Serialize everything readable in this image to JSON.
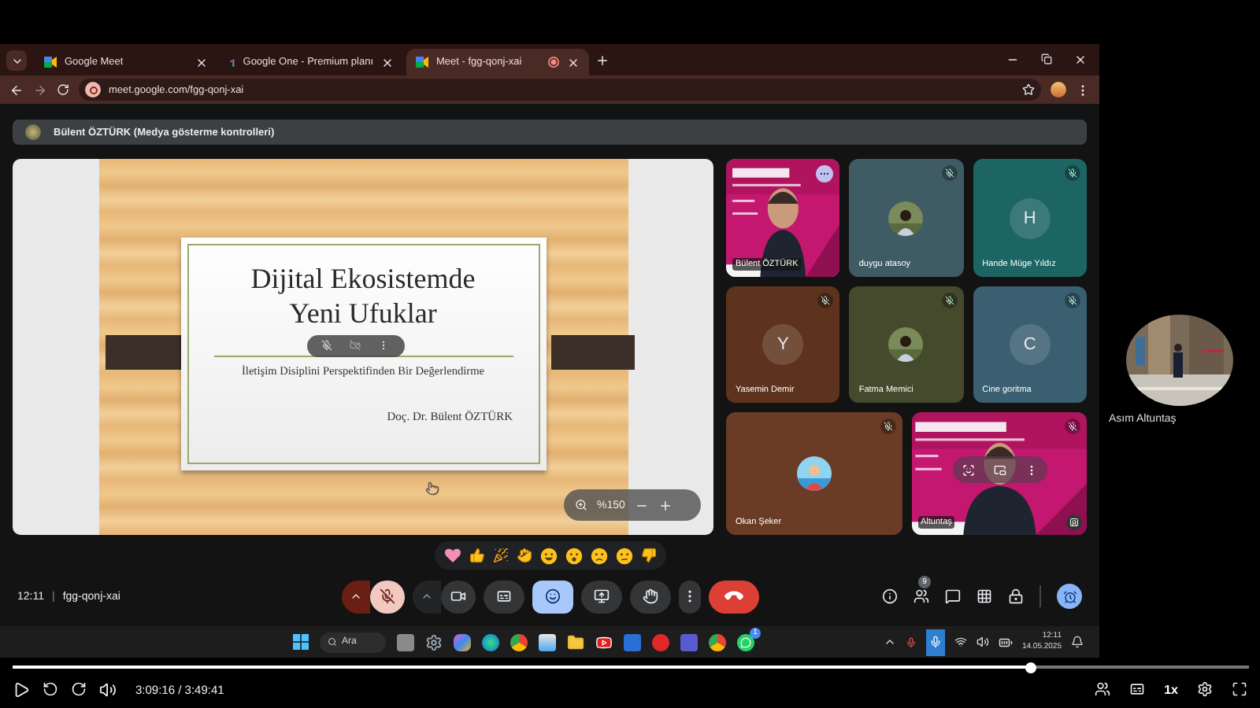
{
  "browser": {
    "tabs": [
      {
        "title": "Google Meet",
        "selected": false
      },
      {
        "title": "Google One - Premium planı",
        "selected": false
      },
      {
        "title": "Meet - fgg-qonj-xai",
        "selected": true
      }
    ],
    "url": "meet.google.com/fgg-qonj-xai"
  },
  "meet": {
    "presenter_bar": "Bülent ÖZTÜRK (Medya gösterme kontrolleri)",
    "slide": {
      "title_lines": [
        "Dijital Ekosistemde",
        "Yeni Ufuklar"
      ],
      "subtitle": "İletişim Disiplini Perspektifinden Bir Değerlendirme",
      "author": "Doç. Dr. Bülent ÖZTÜRK",
      "zoom": "%150"
    },
    "participants": [
      {
        "name": "Bülent ÖZTÜRK",
        "kind": "video",
        "muted": false,
        "highlighted": true
      },
      {
        "name": "duygu atasoy",
        "muted": true,
        "highlighted": false,
        "color": "#3f5c64"
      },
      {
        "name": "Hande Müge Yıldız",
        "kind": "initial",
        "initial": "H",
        "muted": true,
        "highlighted": false,
        "color": "#1d6563"
      },
      {
        "name": "Yasemin Demir",
        "kind": "initial",
        "initial": "Y",
        "muted": true,
        "highlighted": false,
        "color": "#5e331d"
      },
      {
        "name": "Fatma Memici",
        "muted": true,
        "highlighted": false,
        "color": "#454a2c"
      },
      {
        "name": "Cine goritma",
        "kind": "initial",
        "initial": "C",
        "muted": true,
        "highlighted": false,
        "color": "#3a5f70"
      },
      {
        "name": "Okan Şeker",
        "muted": true,
        "highlighted": false,
        "color": "#6a3b25"
      },
      {
        "name": "Altuntaş",
        "kind": "video",
        "muted": true,
        "highlighted": false
      }
    ],
    "time": "12:11",
    "separator": "|",
    "meeting_code": "fgg-qonj-xai",
    "mic_muted": true,
    "reactions_open": true,
    "participant_count": "9"
  },
  "taskbar": {
    "search": "Ara",
    "badge": "1",
    "time": "12:11",
    "date": "14.05.2025"
  },
  "self_view": {
    "name": "Asım Altuntaş"
  },
  "player": {
    "level": 0.824,
    "time": "3:09:16 / 3:49:41",
    "speed": "1x"
  }
}
